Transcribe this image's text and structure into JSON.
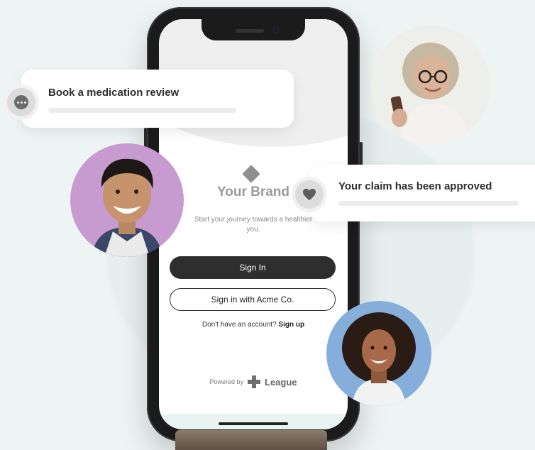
{
  "phone_app": {
    "brand_name": "Your Brand",
    "tagline": "Start your journey towards a healthier you.",
    "sign_in_label": "Sign In",
    "sso_label": "Sign in with Acme Co.",
    "no_account_text": "Don't have an account?",
    "sign_up_link": "Sign up",
    "powered_by": "Powered by",
    "provider_name": "League"
  },
  "cards": {
    "medication": {
      "title": "Book a medication review",
      "icon": "chat-dots-icon"
    },
    "claim": {
      "title": "Your claim has been approved",
      "icon": "heart-icon"
    }
  },
  "colors": {
    "background": "#eef4f3",
    "primary_button": "#2e2e2e",
    "avatar_purple": "#c79ad0",
    "avatar_blue": "#86aedb"
  }
}
